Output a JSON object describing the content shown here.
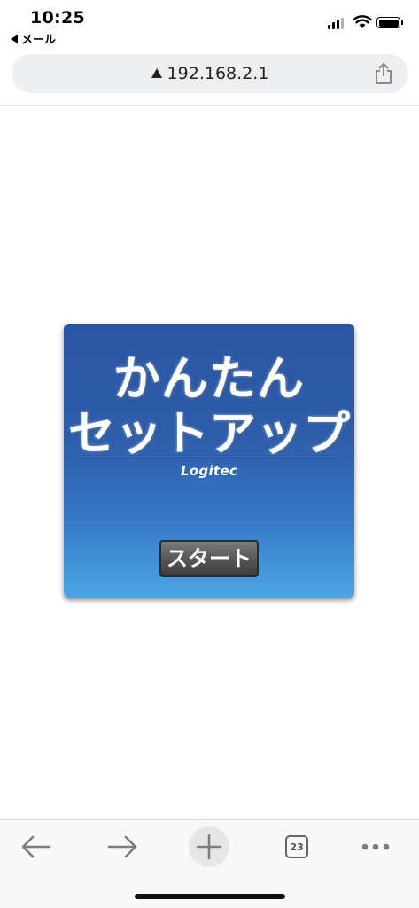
{
  "status_bar": {
    "time": "10:25",
    "back_app": "メール"
  },
  "address_bar": {
    "url": "192.168.2.1"
  },
  "setup_panel": {
    "title_line1": "かんたん",
    "title_line2": "セットアップ",
    "brand": "Logitec",
    "start_label": "スタート"
  },
  "toolbar": {
    "tab_count": "23"
  }
}
